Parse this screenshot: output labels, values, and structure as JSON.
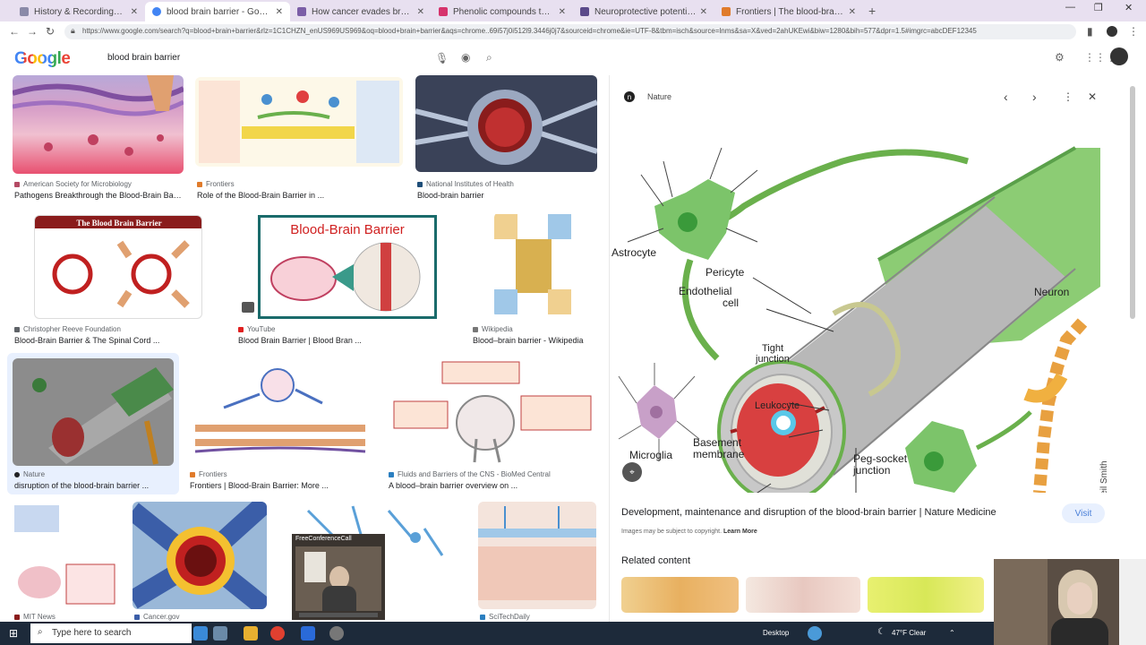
{
  "browser": {
    "tabs": [
      {
        "title": "History & Recordings | FreeConf...",
        "active": false
      },
      {
        "title": "blood brain barrier - Google Se...",
        "active": true
      },
      {
        "title": "How cancer evades breach the ...",
        "active": false
      },
      {
        "title": "Phenolic compounds that cross t...",
        "active": false
      },
      {
        "title": "Neuroprotective potential of ph...",
        "active": false
      },
      {
        "title": "Frontiers | The blood-brain barr...",
        "active": false
      }
    ],
    "new_tab": "+",
    "url": "https://www.google.com/search?q=blood+brain+barrier&rlz=1C1CHZN_enUS969US969&oq=blood+brain+barrier&aqs=chrome..69i57j0i512l9.3446j0j7&sourceid=chrome&ie=UTF-8&tbm=isch&source=lnms&sa=X&ved=2ahUKEwi&biw=1280&bih=577&dpr=1.5#imgrc=abcDEF12345"
  },
  "google": {
    "logo": "Google",
    "query": "blood brain barrier"
  },
  "results": [
    {
      "source": "American Society for Microbiology",
      "caption": "Pathogens Breakthrough the Blood-Brain Barr...",
      "color": "#b44a64"
    },
    {
      "source": "Frontiers",
      "caption": "Role of the Blood-Brain Barrier in ...",
      "color": "#e07b2b"
    },
    {
      "source": "National Institutes of Health",
      "caption": "Blood-brain barrier",
      "color": "#1f4e79"
    },
    {
      "source": "Christopher Reeve Foundation",
      "caption": "Blood-Brain Barrier & The Spinal Cord ...",
      "color": "#5f6368"
    },
    {
      "source": "YouTube",
      "caption": "Blood Brain Barrier | Blood Bran ...",
      "color": "#e02020"
    },
    {
      "source": "Wikipedia",
      "caption": "Blood–brain barrier - Wikipedia",
      "color": "#777777"
    },
    {
      "source": "Nature",
      "caption": "disruption of the blood-brain barrier ...",
      "color": "#202124"
    },
    {
      "source": "Frontiers",
      "caption": "Frontiers | Blood-Brain Barrier: More ...",
      "color": "#e07b2b"
    },
    {
      "source": "Fluids and Barriers of the CNS - BioMed Central",
      "caption": "A blood–brain barrier overview on ...",
      "color": "#2b7fc0"
    },
    {
      "source": "MIT News",
      "caption": "",
      "color": "#8a1c1c"
    },
    {
      "source": "Cancer.gov",
      "caption": "",
      "color": "#3b5ea8"
    },
    {
      "source": "",
      "caption": "",
      "color": "#ffffff"
    },
    {
      "source": "SciTechDaily",
      "caption": "",
      "color": "#2b7fc0"
    }
  ],
  "preview": {
    "source": "Nature",
    "title": "Development, maintenance and disruption of the blood-brain barrier | Nature Medicine",
    "visit": "Visit",
    "copyright": "Images may be subject to copyright.",
    "learn_more": "Learn More",
    "related": "Related content",
    "figure_labels": {
      "astrocyte": "Astrocyte",
      "pericyte": "Pericyte",
      "endothelial": "Endothelial",
      "cell": "cell",
      "neuron": "Neuron",
      "tight": "Tight",
      "junction": "junction",
      "leukocyte": "Leukocyte",
      "microglia": "Microglia",
      "basement": "Basement",
      "membrane": "membrane",
      "pegsocket": "Peg-socket",
      "junction2": "junction",
      "artist": "Neil Smith"
    }
  },
  "video_overlay": {
    "title": "FreeConferenceCall"
  },
  "taskbar": {
    "search_placeholder": "Type here to search",
    "desktop": "Desktop",
    "weather": "47°F  Clear"
  },
  "icons": [
    "back-icon",
    "forward-icon",
    "reload-icon",
    "lock-icon",
    "mic-icon",
    "lens-icon",
    "search-icon",
    "settings-icon",
    "apps-icon",
    "close-icon",
    "more-icon",
    "windows-icon"
  ]
}
